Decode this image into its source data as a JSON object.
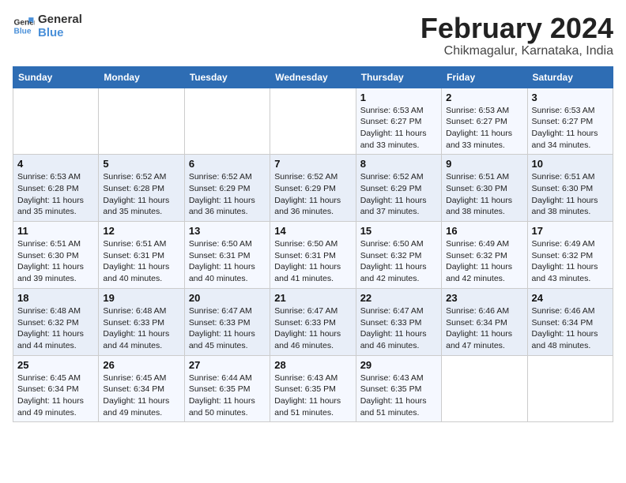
{
  "logo": {
    "line1": "General",
    "line2": "Blue"
  },
  "title": "February 2024",
  "subtitle": "Chikmagalur, Karnataka, India",
  "days_header": [
    "Sunday",
    "Monday",
    "Tuesday",
    "Wednesday",
    "Thursday",
    "Friday",
    "Saturday"
  ],
  "weeks": [
    [
      {
        "day": "",
        "info": ""
      },
      {
        "day": "",
        "info": ""
      },
      {
        "day": "",
        "info": ""
      },
      {
        "day": "",
        "info": ""
      },
      {
        "day": "1",
        "info": "Sunrise: 6:53 AM\nSunset: 6:27 PM\nDaylight: 11 hours\nand 33 minutes."
      },
      {
        "day": "2",
        "info": "Sunrise: 6:53 AM\nSunset: 6:27 PM\nDaylight: 11 hours\nand 33 minutes."
      },
      {
        "day": "3",
        "info": "Sunrise: 6:53 AM\nSunset: 6:27 PM\nDaylight: 11 hours\nand 34 minutes."
      }
    ],
    [
      {
        "day": "4",
        "info": "Sunrise: 6:53 AM\nSunset: 6:28 PM\nDaylight: 11 hours\nand 35 minutes."
      },
      {
        "day": "5",
        "info": "Sunrise: 6:52 AM\nSunset: 6:28 PM\nDaylight: 11 hours\nand 35 minutes."
      },
      {
        "day": "6",
        "info": "Sunrise: 6:52 AM\nSunset: 6:29 PM\nDaylight: 11 hours\nand 36 minutes."
      },
      {
        "day": "7",
        "info": "Sunrise: 6:52 AM\nSunset: 6:29 PM\nDaylight: 11 hours\nand 36 minutes."
      },
      {
        "day": "8",
        "info": "Sunrise: 6:52 AM\nSunset: 6:29 PM\nDaylight: 11 hours\nand 37 minutes."
      },
      {
        "day": "9",
        "info": "Sunrise: 6:51 AM\nSunset: 6:30 PM\nDaylight: 11 hours\nand 38 minutes."
      },
      {
        "day": "10",
        "info": "Sunrise: 6:51 AM\nSunset: 6:30 PM\nDaylight: 11 hours\nand 38 minutes."
      }
    ],
    [
      {
        "day": "11",
        "info": "Sunrise: 6:51 AM\nSunset: 6:30 PM\nDaylight: 11 hours\nand 39 minutes."
      },
      {
        "day": "12",
        "info": "Sunrise: 6:51 AM\nSunset: 6:31 PM\nDaylight: 11 hours\nand 40 minutes."
      },
      {
        "day": "13",
        "info": "Sunrise: 6:50 AM\nSunset: 6:31 PM\nDaylight: 11 hours\nand 40 minutes."
      },
      {
        "day": "14",
        "info": "Sunrise: 6:50 AM\nSunset: 6:31 PM\nDaylight: 11 hours\nand 41 minutes."
      },
      {
        "day": "15",
        "info": "Sunrise: 6:50 AM\nSunset: 6:32 PM\nDaylight: 11 hours\nand 42 minutes."
      },
      {
        "day": "16",
        "info": "Sunrise: 6:49 AM\nSunset: 6:32 PM\nDaylight: 11 hours\nand 42 minutes."
      },
      {
        "day": "17",
        "info": "Sunrise: 6:49 AM\nSunset: 6:32 PM\nDaylight: 11 hours\nand 43 minutes."
      }
    ],
    [
      {
        "day": "18",
        "info": "Sunrise: 6:48 AM\nSunset: 6:32 PM\nDaylight: 11 hours\nand 44 minutes."
      },
      {
        "day": "19",
        "info": "Sunrise: 6:48 AM\nSunset: 6:33 PM\nDaylight: 11 hours\nand 44 minutes."
      },
      {
        "day": "20",
        "info": "Sunrise: 6:47 AM\nSunset: 6:33 PM\nDaylight: 11 hours\nand 45 minutes."
      },
      {
        "day": "21",
        "info": "Sunrise: 6:47 AM\nSunset: 6:33 PM\nDaylight: 11 hours\nand 46 minutes."
      },
      {
        "day": "22",
        "info": "Sunrise: 6:47 AM\nSunset: 6:33 PM\nDaylight: 11 hours\nand 46 minutes."
      },
      {
        "day": "23",
        "info": "Sunrise: 6:46 AM\nSunset: 6:34 PM\nDaylight: 11 hours\nand 47 minutes."
      },
      {
        "day": "24",
        "info": "Sunrise: 6:46 AM\nSunset: 6:34 PM\nDaylight: 11 hours\nand 48 minutes."
      }
    ],
    [
      {
        "day": "25",
        "info": "Sunrise: 6:45 AM\nSunset: 6:34 PM\nDaylight: 11 hours\nand 49 minutes."
      },
      {
        "day": "26",
        "info": "Sunrise: 6:45 AM\nSunset: 6:34 PM\nDaylight: 11 hours\nand 49 minutes."
      },
      {
        "day": "27",
        "info": "Sunrise: 6:44 AM\nSunset: 6:35 PM\nDaylight: 11 hours\nand 50 minutes."
      },
      {
        "day": "28",
        "info": "Sunrise: 6:43 AM\nSunset: 6:35 PM\nDaylight: 11 hours\nand 51 minutes."
      },
      {
        "day": "29",
        "info": "Sunrise: 6:43 AM\nSunset: 6:35 PM\nDaylight: 11 hours\nand 51 minutes."
      },
      {
        "day": "",
        "info": ""
      },
      {
        "day": "",
        "info": ""
      }
    ]
  ]
}
